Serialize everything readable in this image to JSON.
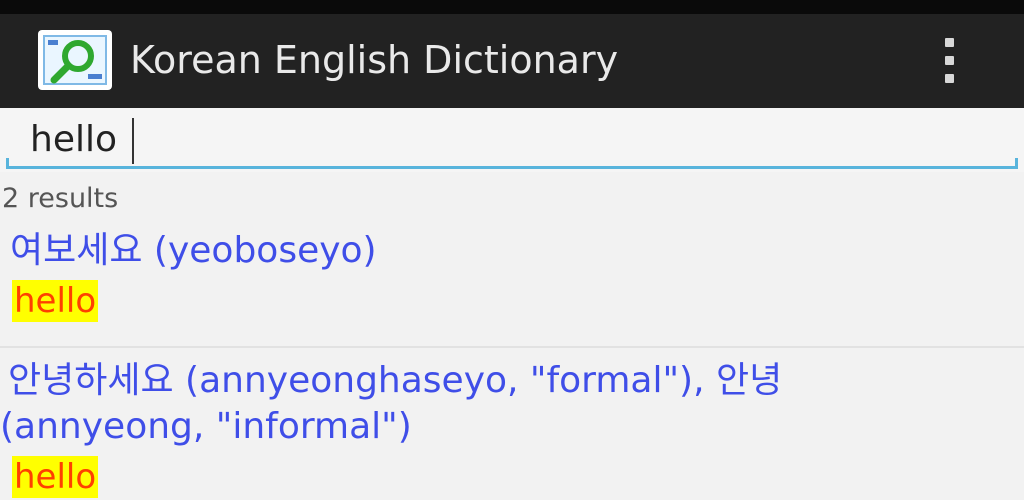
{
  "app": {
    "title": "Korean English Dictionary",
    "icon": "dictionary-magnifier-icon",
    "menu_icon": "overflow-menu-icon"
  },
  "search": {
    "value": "hello",
    "accent_color": "#58b4dc"
  },
  "results": {
    "count_text": "2 results",
    "items": [
      {
        "headword_lines": [
          "여보세요 (yeoboseyo)"
        ],
        "gloss": "hello"
      },
      {
        "headword_lines": [
          "안녕하세요 (annyeonghaseyo, \"formal\"), 안녕",
          "(annyeong, \"informal\")"
        ],
        "gloss": "hello"
      }
    ]
  },
  "colors": {
    "action_bar": "#222222",
    "headword": "#3f4ee8",
    "gloss_text": "#ff4000",
    "gloss_highlight": "#ffff00"
  }
}
